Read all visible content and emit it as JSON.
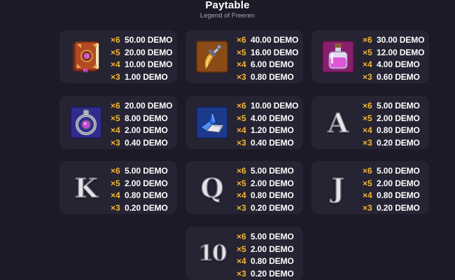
{
  "title": "Paytable",
  "subtitle": "Legend of Freeren",
  "cards": [
    {
      "symbol": "book-icon",
      "pays": [
        {
          "mult": "×6",
          "amount": "50.00 DEMO"
        },
        {
          "mult": "×5",
          "amount": "20.00 DEMO"
        },
        {
          "mult": "×4",
          "amount": "10.00 DEMO"
        },
        {
          "mult": "×3",
          "amount": "1.00 DEMO"
        }
      ]
    },
    {
      "symbol": "dagger-icon",
      "pays": [
        {
          "mult": "×6",
          "amount": "40.00 DEMO"
        },
        {
          "mult": "×5",
          "amount": "16.00 DEMO"
        },
        {
          "mult": "×4",
          "amount": "6.00 DEMO"
        },
        {
          "mult": "×3",
          "amount": "0.80 DEMO"
        }
      ]
    },
    {
      "symbol": "potion-icon",
      "pays": [
        {
          "mult": "×6",
          "amount": "30.00 DEMO"
        },
        {
          "mult": "×5",
          "amount": "12.00 DEMO"
        },
        {
          "mult": "×4",
          "amount": "4.00 DEMO"
        },
        {
          "mult": "×3",
          "amount": "0.60 DEMO"
        }
      ]
    },
    {
      "symbol": "ring-icon",
      "pays": [
        {
          "mult": "×6",
          "amount": "20.00 DEMO"
        },
        {
          "mult": "×5",
          "amount": "8.00 DEMO"
        },
        {
          "mult": "×4",
          "amount": "2.00 DEMO"
        },
        {
          "mult": "×3",
          "amount": "0.40 DEMO"
        }
      ]
    },
    {
      "symbol": "crystal-icon",
      "pays": [
        {
          "mult": "×6",
          "amount": "10.00 DEMO"
        },
        {
          "mult": "×5",
          "amount": "4.00 DEMO"
        },
        {
          "mult": "×4",
          "amount": "1.20 DEMO"
        },
        {
          "mult": "×3",
          "amount": "0.40 DEMO"
        }
      ]
    },
    {
      "symbol": "letter-a-icon",
      "letter": "A",
      "pays": [
        {
          "mult": "×6",
          "amount": "5.00 DEMO"
        },
        {
          "mult": "×5",
          "amount": "2.00 DEMO"
        },
        {
          "mult": "×4",
          "amount": "0.80 DEMO"
        },
        {
          "mult": "×3",
          "amount": "0.20 DEMO"
        }
      ]
    },
    {
      "symbol": "letter-k-icon",
      "letter": "K",
      "pays": [
        {
          "mult": "×6",
          "amount": "5.00 DEMO"
        },
        {
          "mult": "×5",
          "amount": "2.00 DEMO"
        },
        {
          "mult": "×4",
          "amount": "0.80 DEMO"
        },
        {
          "mult": "×3",
          "amount": "0.20 DEMO"
        }
      ]
    },
    {
      "symbol": "letter-q-icon",
      "letter": "Q",
      "pays": [
        {
          "mult": "×6",
          "amount": "5.00 DEMO"
        },
        {
          "mult": "×5",
          "amount": "2.00 DEMO"
        },
        {
          "mult": "×4",
          "amount": "0.80 DEMO"
        },
        {
          "mult": "×3",
          "amount": "0.20 DEMO"
        }
      ]
    },
    {
      "symbol": "letter-j-icon",
      "letter": "J",
      "pays": [
        {
          "mult": "×6",
          "amount": "5.00 DEMO"
        },
        {
          "mult": "×5",
          "amount": "2.00 DEMO"
        },
        {
          "mult": "×4",
          "amount": "0.80 DEMO"
        },
        {
          "mult": "×3",
          "amount": "0.20 DEMO"
        }
      ]
    },
    {
      "symbol": "number-10-icon",
      "letter": "10",
      "pays": [
        {
          "mult": "×6",
          "amount": "5.00 DEMO"
        },
        {
          "mult": "×5",
          "amount": "2.00 DEMO"
        },
        {
          "mult": "×4",
          "amount": "0.80 DEMO"
        },
        {
          "mult": "×3",
          "amount": "0.20 DEMO"
        }
      ]
    }
  ],
  "colors": {
    "background": "#1c1a26",
    "card": "#262433",
    "multiplier": "#f5b733",
    "amount": "#ffffff"
  }
}
